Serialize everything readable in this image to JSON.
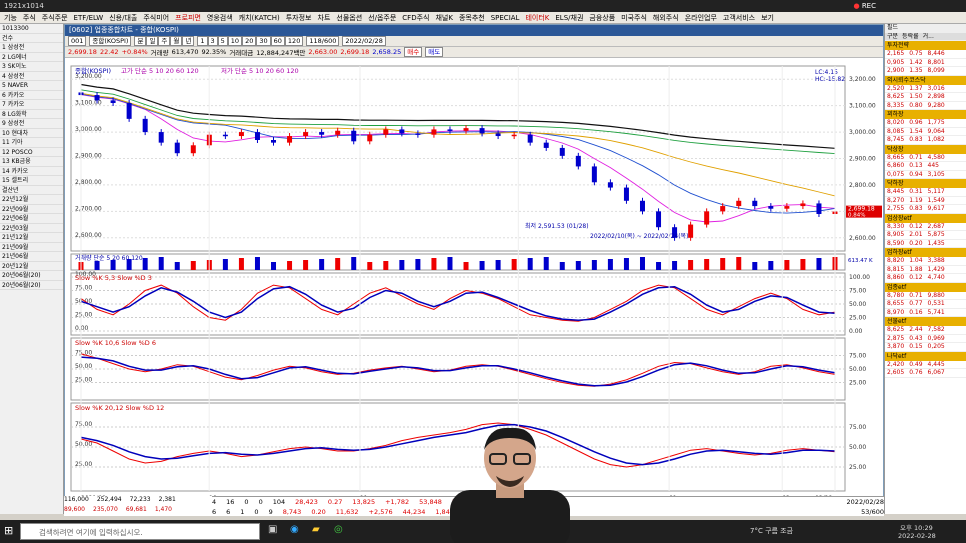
{
  "titlebar": {
    "title": "1921x1014",
    "rec": "REC"
  },
  "menu": [
    "기능",
    "주식",
    "주식주문",
    "ETF/ELW",
    "신용/대출",
    "주식미어",
    "프로피면",
    "영웅검색",
    "캐치(KATCH)",
    "투자정보",
    "차트",
    "선물옵션",
    "선/옵주문",
    "CFD주식",
    "채널K",
    "종목추천",
    "SPECIAL",
    "테이터K",
    "ELS/채권",
    "금융상품",
    "미국주식",
    "해외주식",
    "온라인업무",
    "고객서비스",
    "보기"
  ],
  "chartwin": {
    "title": "[0602] 업종종합차트 - 종합(KOSPI)"
  },
  "toolbar1": {
    "code": "001",
    "name": "종합(KOSPI)",
    "periods": [
      "분",
      "일",
      "주",
      "월",
      "년"
    ],
    "ticks": [
      "1",
      "3",
      "5",
      "10",
      "20",
      "30",
      "60",
      "120"
    ],
    "count": "118/600",
    "date": "2022/02/28"
  },
  "toolbar2": {
    "price": "2,699.18",
    "change": "22.42",
    "pct": "+0.84%",
    "vol_label": "거래량",
    "vol": "613,470",
    "vol_pct": "92.35%",
    "amt_label": "거래대금",
    "amt": "12,884,247백만",
    "open": "2,663.00",
    "high": "2,699.18",
    "low": "2,658.25",
    "buy": "매수",
    "sell": "매도"
  },
  "price_panel": {
    "label": "종합(KOSPI)",
    "ma_label": "고가 단순 5 10 20 60 120",
    "ma2_label": "저가 단순 5 10 20 60 120",
    "yticks": [
      "3,200.00",
      "3,100.00",
      "3,000.00",
      "2,900.00",
      "2,800.00",
      "2,700.00",
      "2,600.00"
    ],
    "last": "2,699.18",
    "last_pct": "0.84%",
    "annot_low": "최저 2,591.53 (01/28)",
    "annot_range": "2022/02/10(목) ~ 2022/02/24(목)",
    "lc": "LC:4.15",
    "hc": "HC:-15.82"
  },
  "vol_panel": {
    "label": "거래량 단순 5 20 60 120",
    "value": "613.47 K",
    "pct": "92.35%"
  },
  "stoch1": {
    "label": "Slow %K 5,3  Slow %D 3",
    "yticks": [
      "100.00",
      "75.00",
      "50.00",
      "25.00",
      "0.00"
    ]
  },
  "stoch2": {
    "label": "Slow %K 10,6  Slow %D 6",
    "yticks": [
      "75.00",
      "50.00",
      "25.00"
    ]
  },
  "stoch3": {
    "label": "Slow %K 20,12  Slow %D 12",
    "yticks": [
      "75.00",
      "50.00",
      "25.00"
    ]
  },
  "xticks": [
    "2021/09",
    "10",
    "11",
    "12",
    "01",
    "02",
    "02/28"
  ],
  "left": {
    "code": "1013300",
    "rows": [
      "건수",
      "1 삼성전",
      "2 LG에너",
      "3 SK이노",
      "4 삼성전",
      "5 NAVER",
      "6 카카오",
      "7 카카오",
      "8 LG화학",
      "9 삼성전",
      "10 현대차",
      "11 기아",
      "12 POSCO",
      "13 KB금융",
      "14 카카오",
      "15 셀트리",
      "결산년",
      "22년12월",
      "22년09월",
      "22년06월",
      "22년03월",
      "21년12월",
      "21년09월",
      "21년06월",
      "20년12월",
      "20년06월(20)",
      "20년06월(20)"
    ]
  },
  "right": {
    "tab": "필드",
    "head": [
      "구분",
      "등락률",
      "거..."
    ],
    "rows": [
      [
        "2,165",
        "0.75",
        "8,446"
      ],
      [
        "0,905",
        "1.42",
        "8,801"
      ],
      [
        "2,900",
        "1.35",
        "8,099"
      ],
      [
        "2,520",
        "1.37",
        "3,016"
      ],
      [
        "8,625",
        "1.50",
        "2,898"
      ],
      [
        "8,335",
        "0.80",
        "9,280"
      ],
      [
        "8,020",
        "0.96",
        "1,775"
      ],
      [
        "8,085",
        "1.54",
        "9,064"
      ],
      [
        "8,745",
        "0.83",
        "1,082"
      ],
      [
        "8,665",
        "0.71",
        "4,580"
      ],
      [
        "6,860",
        "0.13",
        "445"
      ],
      [
        "0,075",
        "0.94",
        "3,105"
      ],
      [
        "8,445",
        "0.31",
        "5,117"
      ],
      [
        "8,270",
        "1.19",
        "1,549"
      ],
      [
        "2,755",
        "0.83",
        "9,617"
      ],
      [
        "8,330",
        "0.12",
        "2,687"
      ],
      [
        "8,905",
        "2.01",
        "5,875"
      ],
      [
        "8,590",
        "0.20",
        "1,435"
      ],
      [
        "8,820",
        "1.04",
        "3,388"
      ],
      [
        "8,815",
        "1.88",
        "1,429"
      ],
      [
        "8,860",
        "0.12",
        "4,740"
      ],
      [
        "8,780",
        "0.71",
        "9,880"
      ],
      [
        "8,655",
        "0.77",
        "0,531"
      ],
      [
        "8,970",
        "0.16",
        "5,741"
      ],
      [
        "8,625",
        "2.44",
        "7,582"
      ],
      [
        "2,875",
        "0.43",
        "0,969"
      ],
      [
        "3,870",
        "0.15",
        "0,205"
      ],
      [
        "2,420",
        "0.49",
        "4,445"
      ],
      [
        "2,605",
        "0.76",
        "6,067"
      ]
    ],
    "sections": [
      "투자전략",
      "외시뢰수코스닥",
      "꾀하장",
      "닥상장",
      "닥하장",
      "업상장etf",
      "업하장etf",
      "업종etf",
      "선물etf",
      "나닥etf",
      "월etf",
      "월etf"
    ]
  },
  "bottom": {
    "row1": [
      "4",
      "16",
      "0",
      "0",
      "104",
      "28,423",
      "0.27",
      "13,825",
      "+1,782",
      "53,848",
      "2,897",
      "14,956",
      "17",
      "17"
    ],
    "row2": [
      "6",
      "6",
      "1",
      "0",
      "9",
      "8,743",
      "0.20",
      "11,632",
      "+2,576",
      "44,234",
      "1,843",
      "333",
      "79",
      "79"
    ],
    "left1": [
      "116,000",
      "252,494",
      "72,233",
      "2,381"
    ],
    "left2": [
      "89,600",
      "235,070",
      "69,681",
      "1,470"
    ],
    "pager": "53/600",
    "date": "2022/02/28"
  },
  "taskbar": {
    "search": "검색하려면 여기에 입력하십시오.",
    "weather": "7°C 구름 조금",
    "time": "오후 10:29",
    "date": "2022-02-28"
  },
  "chart_data": [
    {
      "type": "candlestick",
      "title": "종합(KOSPI)",
      "x": [
        "2021/09",
        "10",
        "11",
        "12",
        "01",
        "02",
        "02/28"
      ],
      "ylim": [
        2550,
        3250
      ],
      "close": [
        3140,
        3120,
        3110,
        3050,
        3000,
        2960,
        2920,
        2950,
        2990,
        2985,
        3000,
        2970,
        2960,
        2985,
        3000,
        2990,
        3005,
        2965,
        2990,
        3010,
        2995,
        2990,
        3010,
        3005,
        3015,
        2995,
        2985,
        2990,
        2960,
        2940,
        2910,
        2870,
        2810,
        2790,
        2740,
        2700,
        2640,
        2600,
        2650,
        2700,
        2720,
        2740,
        2720,
        2710,
        2720,
        2730,
        2690,
        2699.18
      ],
      "grid": true
    },
    {
      "type": "line",
      "title": "Slow %K 5,3  Slow %D 3",
      "ylim": [
        0,
        100
      ],
      "series": [
        {
          "name": "Slow %K",
          "values": [
            60,
            40,
            30,
            50,
            75,
            85,
            70,
            45,
            25,
            20,
            40,
            70,
            85,
            80,
            60,
            40,
            30,
            50,
            70,
            80,
            65,
            50,
            40,
            60,
            75,
            70,
            60,
            45,
            30,
            25,
            20,
            18,
            25,
            40,
            55,
            75,
            85,
            80,
            60,
            40,
            30,
            45,
            60,
            70,
            60,
            40,
            30,
            35
          ]
        },
        {
          "name": "Slow %D",
          "values": [
            55,
            45,
            35,
            45,
            65,
            80,
            72,
            55,
            35,
            25,
            35,
            60,
            78,
            82,
            68,
            48,
            35,
            42,
            62,
            75,
            70,
            55,
            45,
            55,
            70,
            72,
            62,
            50,
            38,
            28,
            22,
            20,
            22,
            35,
            50,
            68,
            80,
            82,
            68,
            48,
            35,
            40,
            55,
            65,
            62,
            48,
            35,
            33
          ]
        }
      ],
      "grid": true
    },
    {
      "type": "line",
      "title": "Slow %K 10,6  Slow %D 6",
      "ylim": [
        0,
        100
      ],
      "series": [
        {
          "name": "Slow %K",
          "values": [
            78,
            70,
            60,
            50,
            45,
            50,
            58,
            55,
            45,
            35,
            30,
            38,
            48,
            55,
            52,
            45,
            40,
            42,
            48,
            52,
            55,
            50,
            45,
            48,
            55,
            58,
            55,
            48,
            40,
            32,
            25,
            20,
            18,
            22,
            30,
            42,
            55,
            62,
            60,
            52,
            45,
            40,
            45,
            55,
            58,
            52,
            45,
            40
          ]
        },
        {
          "name": "Slow %D",
          "values": [
            72,
            70,
            65,
            55,
            48,
            48,
            54,
            56,
            50,
            40,
            32,
            34,
            43,
            52,
            54,
            48,
            42,
            41,
            46,
            50,
            54,
            52,
            47,
            47,
            52,
            56,
            56,
            50,
            43,
            35,
            28,
            22,
            19,
            20,
            26,
            36,
            48,
            58,
            61,
            56,
            48,
            42,
            43,
            50,
            56,
            54,
            48,
            43
          ]
        }
      ],
      "grid": true
    },
    {
      "type": "line",
      "title": "Slow %K 20,12  Slow %D 12",
      "ylim": [
        0,
        100
      ],
      "series": [
        {
          "name": "Slow %K",
          "values": [
            60,
            55,
            45,
            35,
            30,
            32,
            38,
            42,
            45,
            42,
            38,
            40,
            44,
            48,
            50,
            48,
            45,
            45,
            48,
            52,
            58,
            62,
            65,
            68,
            72,
            78,
            80,
            78,
            72,
            65,
            55,
            45,
            35,
            28,
            25,
            28,
            34,
            40,
            46,
            48,
            45,
            42,
            40,
            42,
            46,
            48,
            46,
            44
          ]
        },
        {
          "name": "Slow %D",
          "values": [
            62,
            58,
            52,
            44,
            38,
            35,
            36,
            39,
            42,
            43,
            41,
            40,
            42,
            45,
            48,
            49,
            47,
            46,
            47,
            50,
            54,
            58,
            62,
            65,
            68,
            73,
            77,
            78,
            75,
            70,
            62,
            53,
            44,
            36,
            30,
            28,
            30,
            35,
            41,
            45,
            46,
            44,
            42,
            41,
            43,
            46,
            46,
            45
          ]
        }
      ],
      "grid": true
    }
  ]
}
